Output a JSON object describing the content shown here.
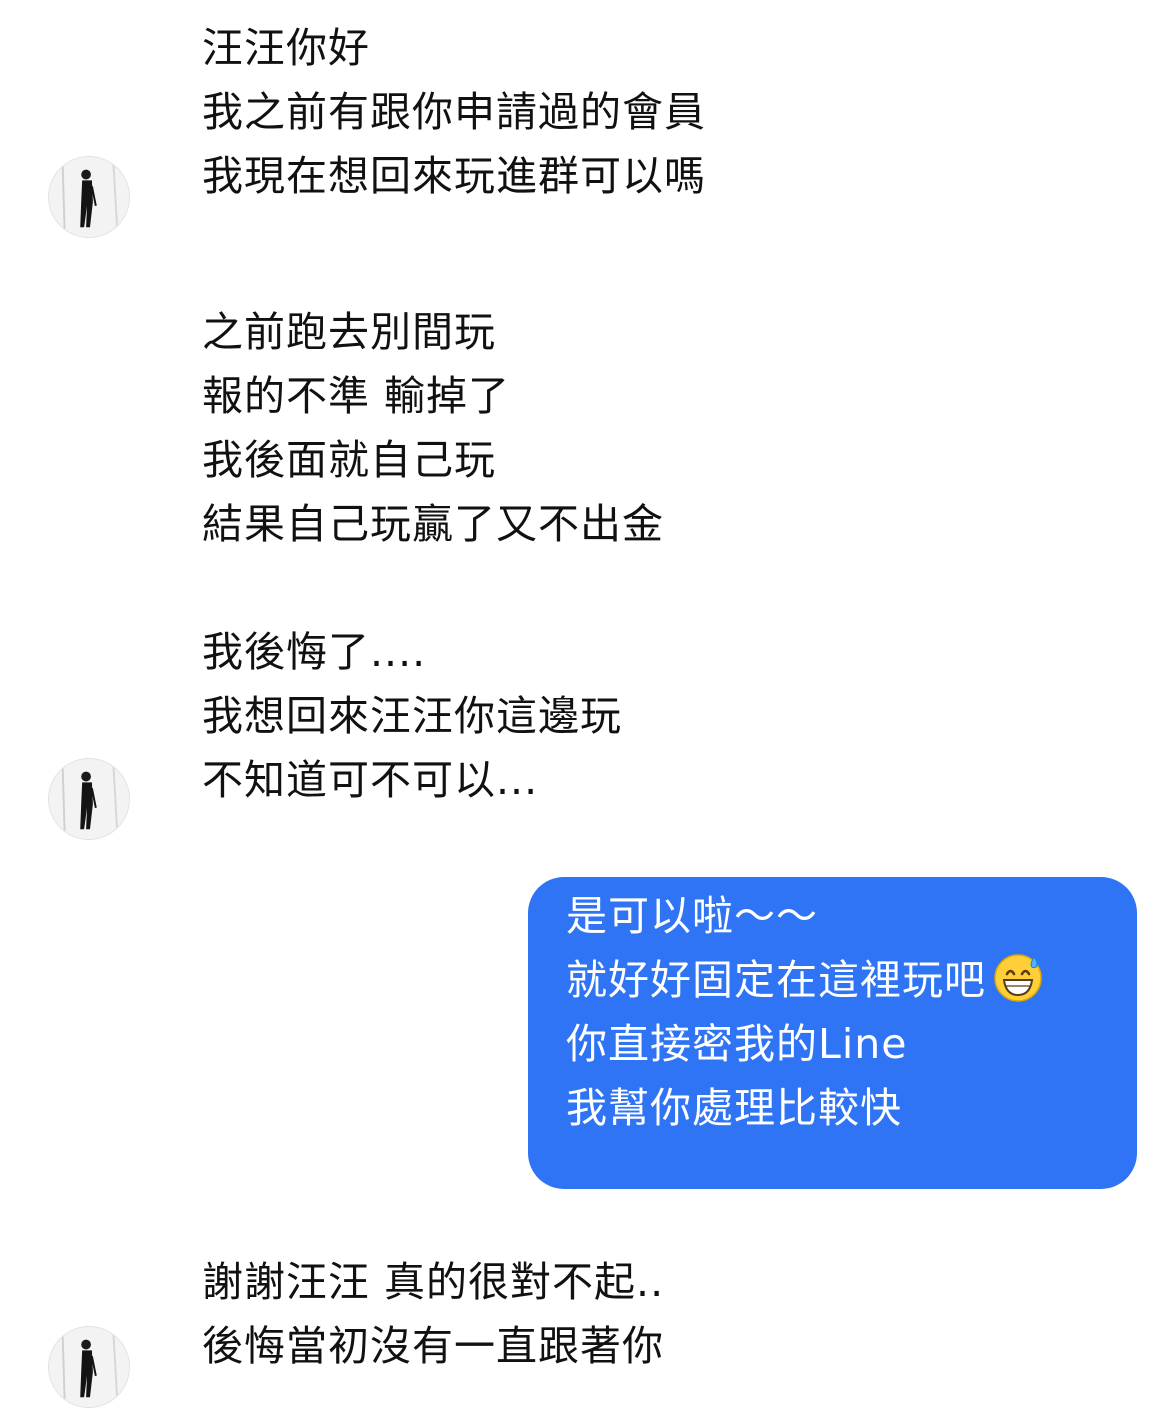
{
  "conversation": {
    "group1": {
      "lines": [
        "汪汪你好",
        "我之前有跟你申請過的會員",
        "我現在想回來玩進群可以嗎"
      ]
    },
    "group2": {
      "lines": [
        "之前跑去別間玩",
        "報的不準 輸掉了",
        "我後面就自己玩",
        "結果自己玩贏了又不出金"
      ]
    },
    "group3": {
      "lines": [
        "我後悔了....",
        "我想回來汪汪你這邊玩",
        "不知道可不可以..."
      ]
    },
    "outgoing": {
      "lines": [
        "是可以啦～～",
        "就好好固定在這裡玩吧",
        "你直接密我的Line",
        "我幫你處理比較快"
      ],
      "emoji": "grinning-face-with-sweat-emoji",
      "bubble_color": "#2f74f5"
    },
    "group4": {
      "lines": [
        "謝謝汪汪 真的很對不起..",
        "後悔當初沒有一直跟著你"
      ]
    },
    "avatar_icon": "person-avatar-icon"
  }
}
